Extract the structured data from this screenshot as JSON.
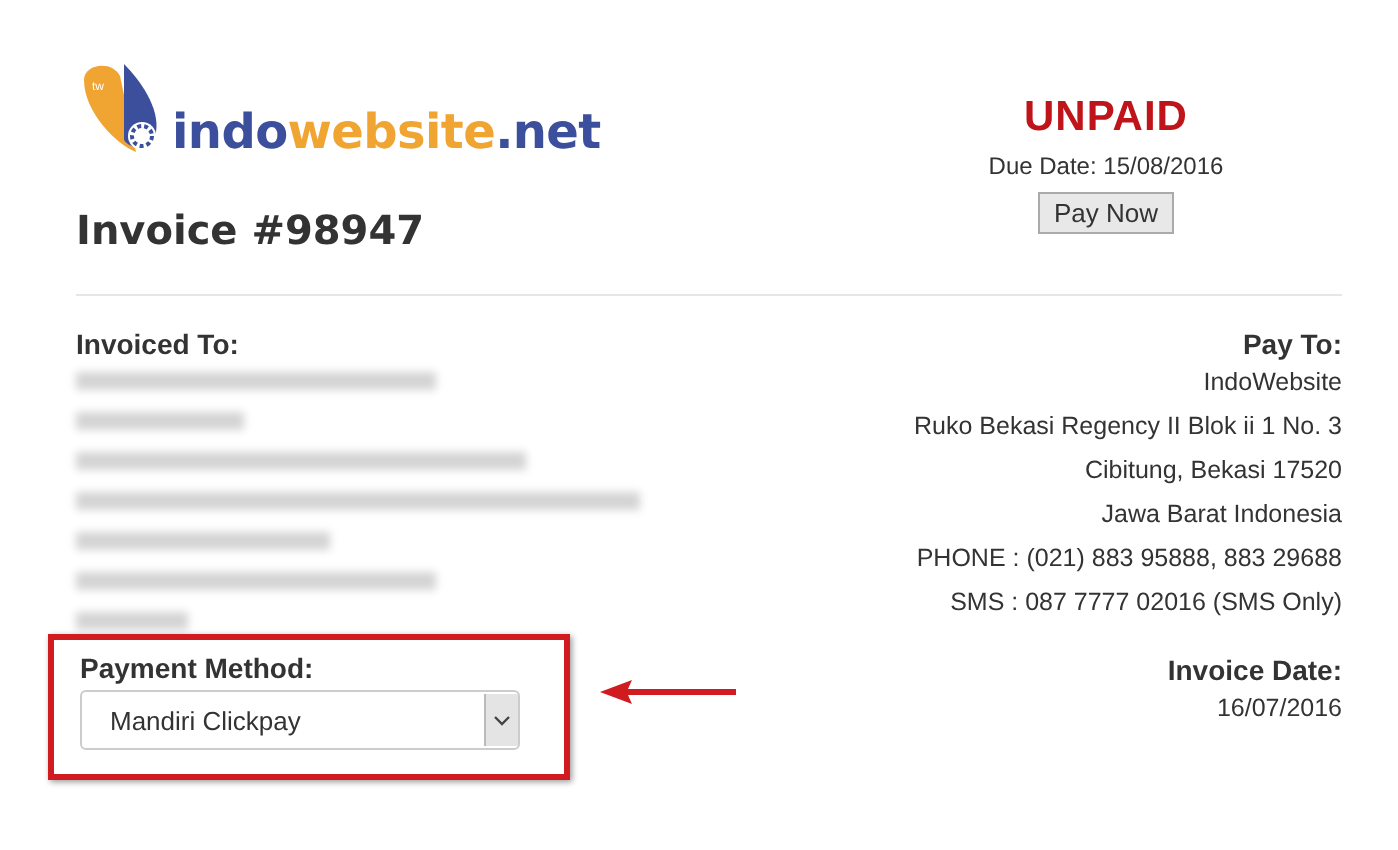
{
  "logo": {
    "badge": "tw",
    "parts": [
      "indo",
      "website",
      ".net"
    ]
  },
  "invoice_title": "Invoice #98947",
  "status": {
    "label": "UNPAID",
    "due_date": "Due Date: 15/08/2016",
    "button": "Pay Now"
  },
  "invoiced_to": {
    "heading": "Invoiced To:",
    "redacted": true
  },
  "pay_to": {
    "heading": "Pay To:",
    "lines": [
      "IndoWebsite",
      "Ruko Bekasi Regency II Blok ii 1 No. 3",
      "Cibitung, Bekasi 17520",
      "Jawa Barat Indonesia",
      "PHONE : (021) 883 95888, 883 29688",
      "SMS : 087 7777 02016 (SMS Only)"
    ]
  },
  "payment_method": {
    "label": "Payment Method:",
    "value": "Mandiri Clickpay",
    "highlighted": true
  },
  "invoice_date": {
    "label": "Invoice Date:",
    "value": "16/07/2016"
  }
}
